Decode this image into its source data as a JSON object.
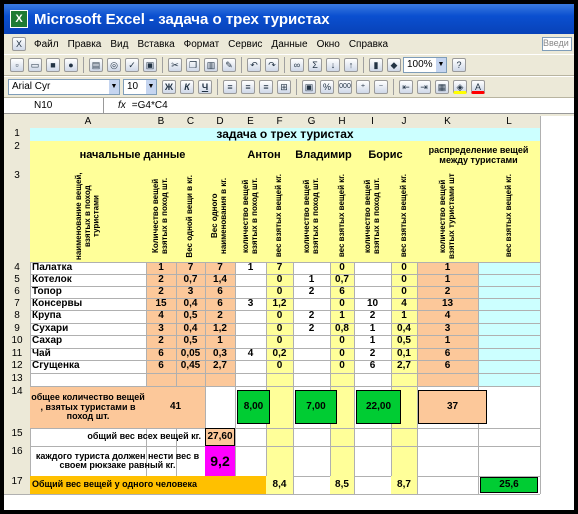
{
  "window": {
    "title": "Microsoft Excel - задача о трех туристах"
  },
  "menu": [
    "Файл",
    "Правка",
    "Вид",
    "Вставка",
    "Формат",
    "Сервис",
    "Данные",
    "Окно",
    "Справка"
  ],
  "help_box": "Введи",
  "toolbar": {
    "zoom": "100%",
    "font": "Arial Cyr",
    "size": "10",
    "bold": "Ж",
    "italic": "К",
    "underline": "Ч",
    "percent": "%",
    "comma": "000"
  },
  "formula_bar": {
    "name_box": "N10",
    "fx": "fx",
    "formula": "=G4*C4"
  },
  "columns": [
    "A",
    "B",
    "C",
    "D",
    "E",
    "F",
    "G",
    "H",
    "I",
    "J",
    "K",
    "L"
  ],
  "rows": [
    "1",
    "2",
    "3",
    "4",
    "5",
    "6",
    "7",
    "8",
    "9",
    "10",
    "11",
    "12",
    "13",
    "14",
    "15",
    "16",
    "17"
  ],
  "sheet": {
    "title": "задача о трех туристах",
    "initial_data": "начальные данные",
    "anton": "Антон",
    "vladimir": "Владимир",
    "boris": "Борис",
    "distribution": "распределение вещей между туристами",
    "h_name": "наименование вещей, взятых в поход туристами",
    "h_qty": "Количество вещей взятых в поход шт.",
    "h_weight": "Вес одной вещи в кг.",
    "h_total": "Вес одного наименования в кг.",
    "h_pqty": "количество вещей взятых в поход шт.",
    "h_pweight": "вес взятых вещей кг.",
    "h_dqty": "количество вещей взятых туристами шт",
    "h_dweight": "вес взятых вещей кг.",
    "items": [
      {
        "name": "Палатка",
        "qty": "1",
        "w": "7",
        "tot": "7",
        "e": "1",
        "f": "7",
        "g": "",
        "h": "0",
        "i": "",
        "j": "0",
        "k": "1"
      },
      {
        "name": "Котелок",
        "qty": "2",
        "w": "0,7",
        "tot": "1,4",
        "e": "",
        "f": "0",
        "g": "1",
        "h": "0,7",
        "i": "",
        "j": "0",
        "k": "1"
      },
      {
        "name": "Топор",
        "qty": "2",
        "w": "3",
        "tot": "6",
        "e": "",
        "f": "0",
        "g": "2",
        "h": "6",
        "i": "",
        "j": "0",
        "k": "2"
      },
      {
        "name": "Консервы",
        "qty": "15",
        "w": "0,4",
        "tot": "6",
        "e": "3",
        "f": "1,2",
        "g": "",
        "h": "0",
        "i": "10",
        "j": "4",
        "k": "13"
      },
      {
        "name": "Крупа",
        "qty": "4",
        "w": "0,5",
        "tot": "2",
        "e": "",
        "f": "0",
        "g": "2",
        "h": "1",
        "i": "2",
        "j": "1",
        "k": "4"
      },
      {
        "name": "Сухари",
        "qty": "3",
        "w": "0,4",
        "tot": "1,2",
        "e": "",
        "f": "0",
        "g": "2",
        "h": "0,8",
        "i": "1",
        "j": "0,4",
        "k": "3"
      },
      {
        "name": "Сахар",
        "qty": "2",
        "w": "0,5",
        "tot": "1",
        "e": "",
        "f": "0",
        "g": "",
        "h": "0",
        "i": "1",
        "j": "0,5",
        "k": "1"
      },
      {
        "name": "Чай",
        "qty": "6",
        "w": "0,05",
        "tot": "0,3",
        "e": "4",
        "f": "0,2",
        "g": "",
        "h": "0",
        "i": "2",
        "j": "0,1",
        "k": "6"
      },
      {
        "name": "Сгущенка",
        "qty": "6",
        "w": "0,45",
        "tot": "2,7",
        "e": "",
        "f": "0",
        "g": "",
        "h": "0",
        "i": "6",
        "j": "2,7",
        "k": "6"
      }
    ],
    "r14_label": "общее количество вещей , взятых туристами в поход  шт.",
    "r14_total": "41",
    "r14_anton": "8,00",
    "r14_vlad": "7,00",
    "r14_boris": "22,00",
    "r14_dist": "37",
    "r15_label": "общий вес всех вещей     кг.",
    "r15_val": "27,60",
    "r16_label": "каждого туриста должен нести вес в своем рюкзаке равный     кг.",
    "r16_val": "9,2",
    "r17_label": "Общий вес вещей у одного человека",
    "r17_f": "8,4",
    "r17_h": "8,5",
    "r17_j": "8,7",
    "r17_l": "25,6"
  },
  "colors": {
    "yellow": "#ffff99",
    "orange": "#fcc89a",
    "green": "#00cc33",
    "cyan": "#ccffff",
    "magenta": "#ff00ff",
    "amber": "#ffc000",
    "title": "#0a4fd0"
  }
}
